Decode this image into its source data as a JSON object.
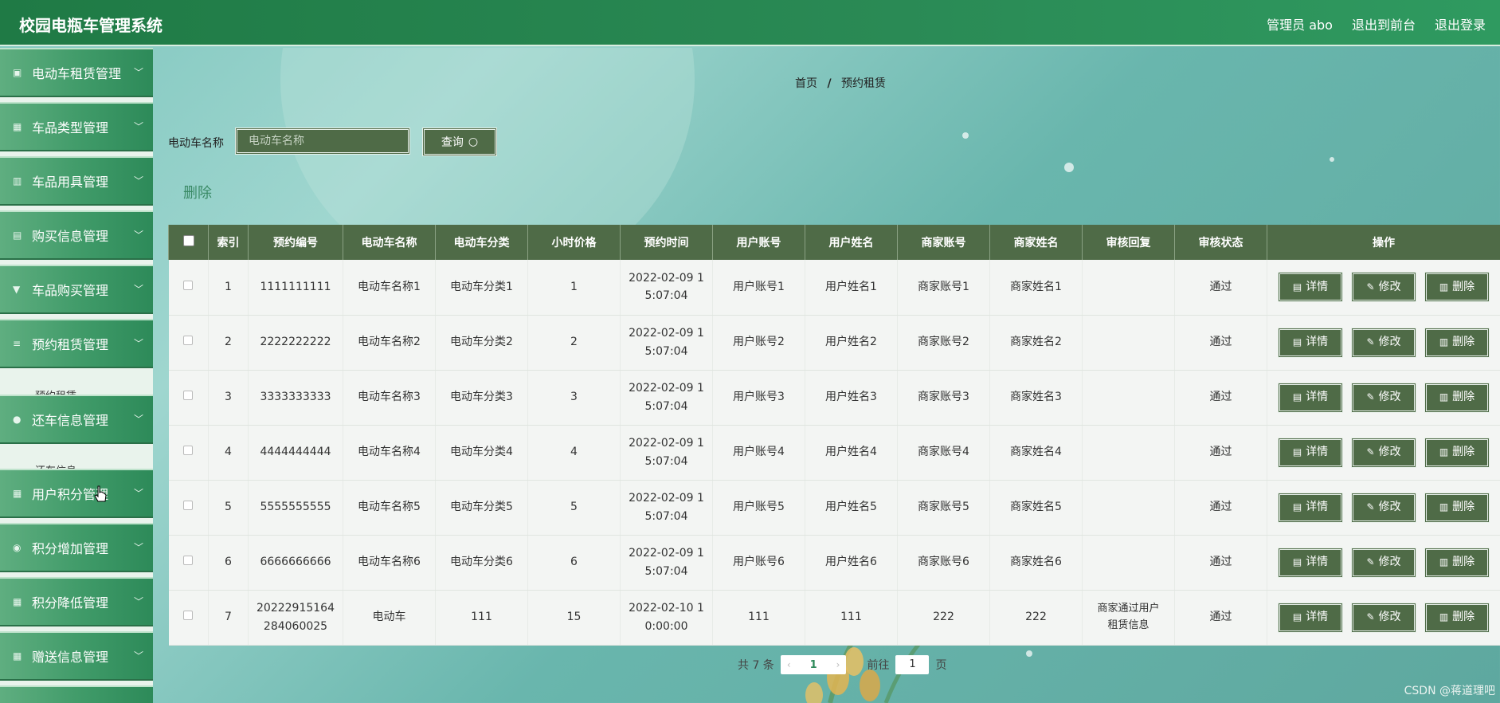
{
  "header": {
    "title": "校园电瓶车管理系统",
    "admin": "管理员 abo",
    "exit_front": "退出到前台",
    "logout": "退出登录"
  },
  "sidebar": {
    "items": [
      {
        "label": "电动车租赁管理",
        "icon": "checkbox-icon"
      },
      {
        "label": "车品类型管理",
        "icon": "grid-icon"
      },
      {
        "label": "车品用具管理",
        "icon": "chart-icon"
      },
      {
        "label": "购买信息管理",
        "icon": "briefcase-icon"
      },
      {
        "label": "车品购买管理",
        "icon": "cup-icon"
      },
      {
        "label": "预约租赁管理",
        "icon": "list-icon"
      },
      {
        "label": "还车信息管理",
        "icon": "user-icon"
      },
      {
        "label": "用户积分管理",
        "icon": "grid-icon"
      },
      {
        "label": "积分增加管理",
        "icon": "pin-icon"
      },
      {
        "label": "积分降低管理",
        "icon": "grid-icon"
      },
      {
        "label": "赠送信息管理",
        "icon": "grid-icon"
      }
    ],
    "sub_rent": "预约租赁",
    "sub_return": "还车信息"
  },
  "breadcrumb": {
    "home": "首页",
    "sep": "/",
    "current": "预约租赁"
  },
  "search": {
    "label": "电动车名称",
    "placeholder": "电动车名称",
    "button": "查询"
  },
  "actions": {
    "delete": "删除"
  },
  "table": {
    "headers": [
      "索引",
      "预约编号",
      "电动车名称",
      "电动车分类",
      "小时价格",
      "预约时间",
      "用户账号",
      "用户姓名",
      "商家账号",
      "商家姓名",
      "审核回复",
      "审核状态",
      "操作"
    ],
    "rows": [
      {
        "idx": "1",
        "code": "1111111111",
        "name": "电动车名称1",
        "category": "电动车分类1",
        "price": "1",
        "time1": "2022-02-09 1",
        "time2": "5:07:04",
        "user": "用户账号1",
        "uname": "用户姓名1",
        "merchant": "商家账号1",
        "mname": "商家姓名1",
        "reply1": "",
        "reply2": "",
        "status": "通过"
      },
      {
        "idx": "2",
        "code": "2222222222",
        "name": "电动车名称2",
        "category": "电动车分类2",
        "price": "2",
        "time1": "2022-02-09 1",
        "time2": "5:07:04",
        "user": "用户账号2",
        "uname": "用户姓名2",
        "merchant": "商家账号2",
        "mname": "商家姓名2",
        "reply1": "",
        "reply2": "",
        "status": "通过"
      },
      {
        "idx": "3",
        "code": "3333333333",
        "name": "电动车名称3",
        "category": "电动车分类3",
        "price": "3",
        "time1": "2022-02-09 1",
        "time2": "5:07:04",
        "user": "用户账号3",
        "uname": "用户姓名3",
        "merchant": "商家账号3",
        "mname": "商家姓名3",
        "reply1": "",
        "reply2": "",
        "status": "通过"
      },
      {
        "idx": "4",
        "code": "4444444444",
        "name": "电动车名称4",
        "category": "电动车分类4",
        "price": "4",
        "time1": "2022-02-09 1",
        "time2": "5:07:04",
        "user": "用户账号4",
        "uname": "用户姓名4",
        "merchant": "商家账号4",
        "mname": "商家姓名4",
        "reply1": "",
        "reply2": "",
        "status": "通过"
      },
      {
        "idx": "5",
        "code": "5555555555",
        "name": "电动车名称5",
        "category": "电动车分类5",
        "price": "5",
        "time1": "2022-02-09 1",
        "time2": "5:07:04",
        "user": "用户账号5",
        "uname": "用户姓名5",
        "merchant": "商家账号5",
        "mname": "商家姓名5",
        "reply1": "",
        "reply2": "",
        "status": "通过"
      },
      {
        "idx": "6",
        "code": "6666666666",
        "name": "电动车名称6",
        "category": "电动车分类6",
        "price": "6",
        "time1": "2022-02-09 1",
        "time2": "5:07:04",
        "user": "用户账号6",
        "uname": "用户姓名6",
        "merchant": "商家账号6",
        "mname": "商家姓名6",
        "reply1": "",
        "reply2": "",
        "status": "通过"
      },
      {
        "idx": "7",
        "code": "20222915164",
        "code2": "284060025",
        "name": "电动车",
        "category": "111",
        "price": "15",
        "time1": "2022-02-10 1",
        "time2": "0:00:00",
        "user": "111",
        "uname": "111",
        "merchant": "222",
        "mname": "222",
        "reply1": "商家通过用户",
        "reply2": "租赁信息",
        "status": "通过"
      }
    ],
    "ops": {
      "detail": "详情",
      "edit": "修改",
      "delete": "删除"
    }
  },
  "pagination": {
    "total": "共 7 条",
    "current_page": "1",
    "goto_prefix": "前往",
    "goto_value": "1",
    "goto_suffix": "页"
  },
  "watermark": "CSDN @蒋道理吧",
  "colors": {
    "primary": "#2a8a55",
    "table_header": "#4f6b47",
    "accent_text": "#3a8a66"
  }
}
